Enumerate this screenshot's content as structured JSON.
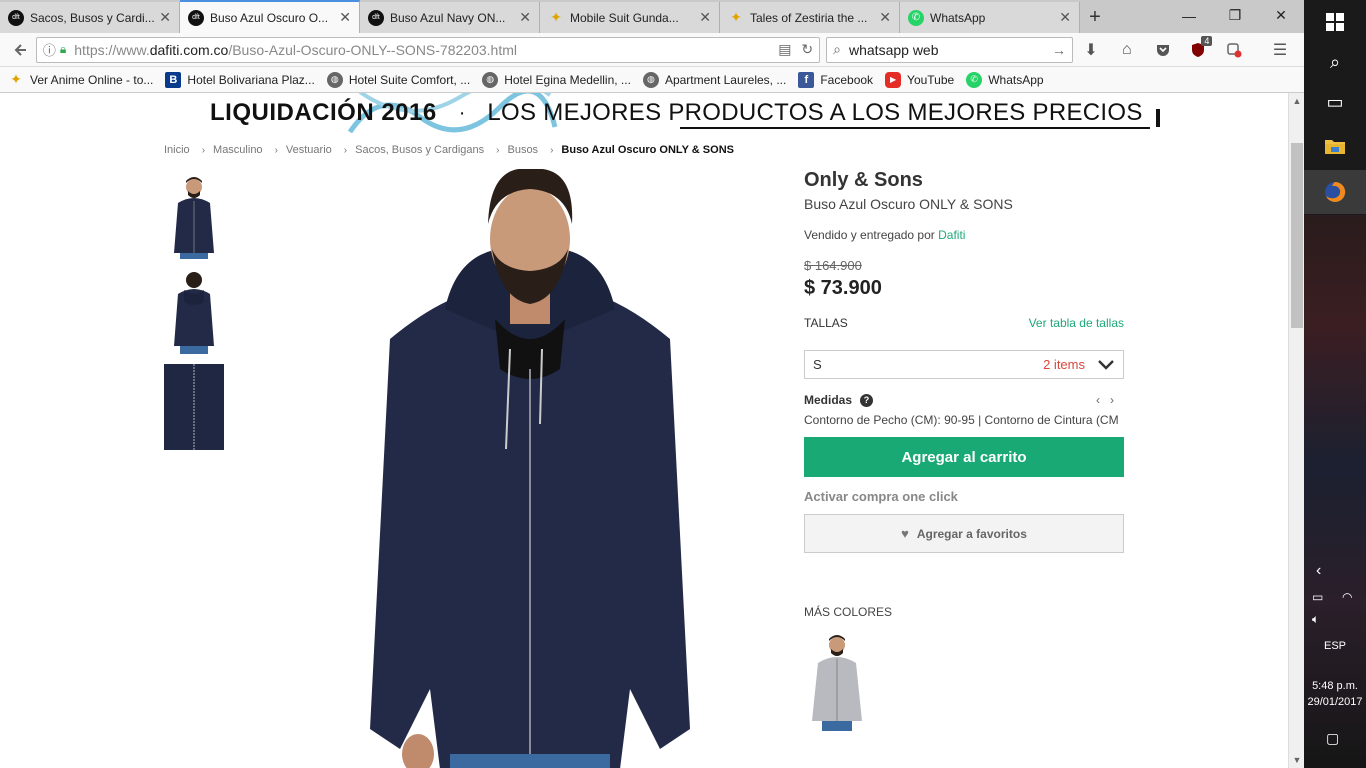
{
  "browser": {
    "tabs": [
      {
        "label": "Sacos, Busos y Cardi...",
        "icon": "dft",
        "active": false
      },
      {
        "label": "Buso Azul Oscuro O...",
        "icon": "dft",
        "active": true
      },
      {
        "label": "Buso Azul Navy ON...",
        "icon": "dft",
        "active": false
      },
      {
        "label": "Mobile Suit Gunda...",
        "icon": "star",
        "active": false
      },
      {
        "label": "Tales of Zestiria the ...",
        "icon": "star",
        "active": false
      },
      {
        "label": "WhatsApp",
        "icon": "whatsapp",
        "active": false
      }
    ],
    "url_prefix": "https://www.",
    "url_domain": "dafiti.com.co",
    "url_path": "/Buso-Azul-Oscuro-ONLY--SONS-782203.html",
    "search_value": "whatsapp web",
    "ublock_badge": "4",
    "bookmarks": [
      {
        "label": "Ver Anime Online - to...",
        "icon": "star"
      },
      {
        "label": "Hotel Bolivariana Plaz...",
        "icon": "booking"
      },
      {
        "label": "Hotel Suite Comfort, ...",
        "icon": "globe"
      },
      {
        "label": "Hotel Egina Medellin, ...",
        "icon": "globe"
      },
      {
        "label": "Apartment Laureles, ...",
        "icon": "globe"
      },
      {
        "label": "Facebook",
        "icon": "facebook"
      },
      {
        "label": "YouTube",
        "icon": "youtube"
      },
      {
        "label": "WhatsApp",
        "icon": "whatsapp"
      }
    ]
  },
  "promo": {
    "bold": "LIQUIDACIÓN 2016",
    "separator": "·",
    "light": "LOS MEJORES PRODUCTOS A LOS MEJORES PRECIOS"
  },
  "breadcrumb": [
    "Inicio",
    "Masculino",
    "Vestuario",
    "Sacos, Busos y Cardigans",
    "Busos",
    "Buso Azul Oscuro ONLY & SONS"
  ],
  "product": {
    "brand": "Only & Sons",
    "name": "Buso Azul Oscuro ONLY & SONS",
    "seller_prefix": "Vendido y entregado por",
    "seller": "Dafiti",
    "old_price": "$ 164.900",
    "price": "$ 73.900",
    "sizes_label": "TALLAS",
    "size_chart_link": "Ver tabla de tallas",
    "selected_size": "S",
    "stock_text": "2 items",
    "medidas_label": "Medidas",
    "medidas_text": "Contorno de Pecho (CM): 90-95 | Contorno de Cintura (CM",
    "add_to_cart": "Agregar al carrito",
    "one_click": "Activar compra one click",
    "favorites": "Agregar a favoritos",
    "more_colors": "MÁS COLORES"
  },
  "colors": {
    "accent_green": "#19a974",
    "stock_red": "#d9473e",
    "jacket_navy": "#222a47"
  },
  "system": {
    "language": "ESP",
    "time": "5:48 p.m.",
    "date": "29/01/2017"
  }
}
